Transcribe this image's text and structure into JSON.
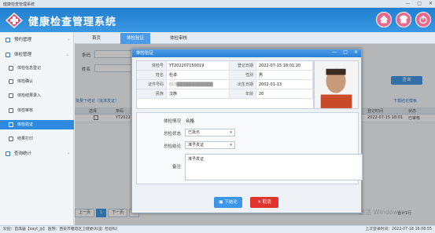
{
  "window": {
    "title": "健康检查管理系统",
    "controls": [
      "—",
      "□",
      "✕"
    ]
  },
  "header": {
    "app_title": "健康检查管理系统",
    "icons": [
      "home-icon",
      "shirt-icon",
      "power-icon"
    ]
  },
  "sidebar": {
    "items": [
      {
        "label": "预约管理",
        "icon": "calendar-icon",
        "arrow": "›"
      },
      {
        "label": "体检管理",
        "icon": "clipboard-icon",
        "arrow": "⌄"
      },
      {
        "label": "体检信息登记",
        "icon": "edit-icon"
      },
      {
        "label": "体检确认",
        "icon": "check-icon"
      },
      {
        "label": "体检结果录入",
        "icon": "document-icon"
      },
      {
        "label": "体检审核",
        "icon": "audit-icon"
      },
      {
        "label": "体检验证",
        "icon": "verify-icon",
        "active": true
      },
      {
        "label": "结果打印",
        "icon": "print-icon"
      },
      {
        "label": "查询统计",
        "icon": "chart-icon",
        "arrow": "›"
      }
    ]
  },
  "tabs": [
    {
      "label": "首页"
    },
    {
      "label": "体检验证",
      "active": true
    },
    {
      "label": "体检审核"
    }
  ],
  "filters": {
    "row1_label": "条码",
    "row2_label": "姓名",
    "search_label": "查询"
  },
  "links": {
    "batch": "批量下结论（批准发证）",
    "report": "下载结论模板"
  },
  "grid": {
    "headers": [
      "选择",
      "条码",
      "登记时间",
      "状态"
    ],
    "rows": [
      {
        "code": "YT2022",
        "date": "2022-07-15 18:01",
        "status": "已审核"
      }
    ]
  },
  "pager": {
    "first": "上一页",
    "page": "1",
    "next": "下一页",
    "last": "»",
    "total": "合计1行"
  },
  "watermark": "激活 Windows",
  "statusbar": {
    "left": "欢迎：首席器【xayt_jy】 医院：西安市雁塔区卫健委(科室: 检验科)",
    "right": "上次登录时间：2022-07-18 16:08:55"
  },
  "dialog": {
    "title": "体检验证",
    "info": {
      "code_label": "体检号",
      "code": "YT202207150019",
      "regdate_label": "登记日期",
      "regdate": "2022-07-15 18:01:20",
      "name_label": "姓名",
      "name": "杜卓",
      "sex_label": "性别",
      "sex": "男",
      "id_label": "证件号码",
      "id": "610████████████",
      "birth_label": "出生日期",
      "birth": "2002-01-13",
      "nation_label": "民族",
      "nation": "汉族",
      "age_label": "年龄",
      "age": "20"
    },
    "section": {
      "status_label": "体检情况",
      "status": "合格",
      "audit_label": "总检状态",
      "audit": "已批示",
      "result_label": "总检结论",
      "result": "准予发证",
      "remark_label": "备注",
      "remark": "准予发证"
    },
    "buttons": {
      "print": "下结论",
      "cancel": "取消"
    }
  },
  "colors": {
    "primary": "#2d8ae0",
    "danger": "#e0342c",
    "header": "#1f7fd0"
  }
}
